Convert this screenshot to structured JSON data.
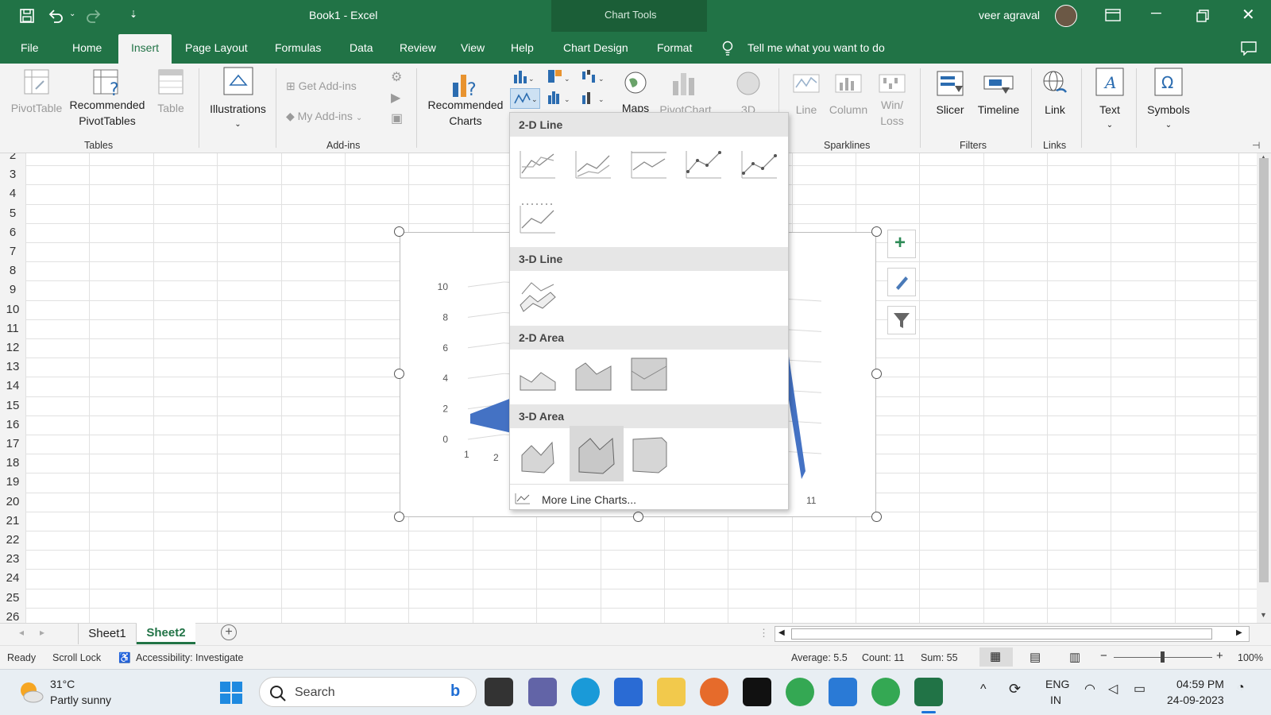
{
  "window": {
    "doc_title": "Book1  -  Excel",
    "context": "Chart Tools",
    "user": "veer agraval"
  },
  "tabs": [
    "File",
    "Home",
    "Insert",
    "Page Layout",
    "Formulas",
    "Data",
    "Review",
    "View",
    "Help",
    "Chart Design",
    "Format"
  ],
  "tell_me": "Tell me what you want to do",
  "ribbon": {
    "pivottable": "PivotTable",
    "recommended_pivot": "Recommended PivotTables",
    "table": "Table",
    "tables_group": "Tables",
    "illustrations": "Illustrations",
    "get_addins": "Get Add-ins",
    "my_addins": "My Add-ins",
    "addins_group": "Add-ins",
    "rec_charts": "Recommended Charts",
    "maps": "Maps",
    "pivotchart": "PivotChart",
    "map3d": "3D",
    "line": "Line",
    "column": "Column",
    "winloss": "Win/ Loss",
    "sparklines_group": "Sparklines",
    "slicer": "Slicer",
    "timeline": "Timeline",
    "filters_group": "Filters",
    "link": "Link",
    "links_group": "Links",
    "text": "Text",
    "symbols": "Symbols"
  },
  "rows": [
    "2",
    "3",
    "4",
    "5",
    "6",
    "7",
    "8",
    "9",
    "10",
    "11",
    "12",
    "13",
    "14",
    "15",
    "16",
    "17",
    "18",
    "19",
    "20",
    "21",
    "22",
    "23",
    "24",
    "25",
    "26"
  ],
  "dropdown": {
    "s1": "2-D Line",
    "s2": "3-D Line",
    "s3": "2-D Area",
    "s4": "3-D Area",
    "more": "More Line Charts..."
  },
  "chart_data": {
    "type": "area",
    "y_ticks": [
      "10",
      "8",
      "6",
      "4",
      "2",
      "0"
    ],
    "x_ticks": [
      "1",
      "2",
      "11"
    ],
    "ylim": [
      0,
      10
    ]
  },
  "sheets": [
    "Sheet1",
    "Sheet2"
  ],
  "status": {
    "ready": "Ready",
    "scroll": "Scroll Lock",
    "access": "Accessibility: Investigate",
    "avg": "Average: 5.5",
    "count": "Count: 11",
    "sum": "Sum: 55",
    "zoom": "100%"
  },
  "taskbar": {
    "temp": "31°C",
    "weather": "Partly sunny",
    "search": "Search",
    "lang1": "ENG",
    "lang2": "IN",
    "time": "04:59 PM",
    "date": "24-09-2023"
  },
  "colors": {
    "excel_green": "#217346",
    "area_blue": "#4472c4"
  }
}
